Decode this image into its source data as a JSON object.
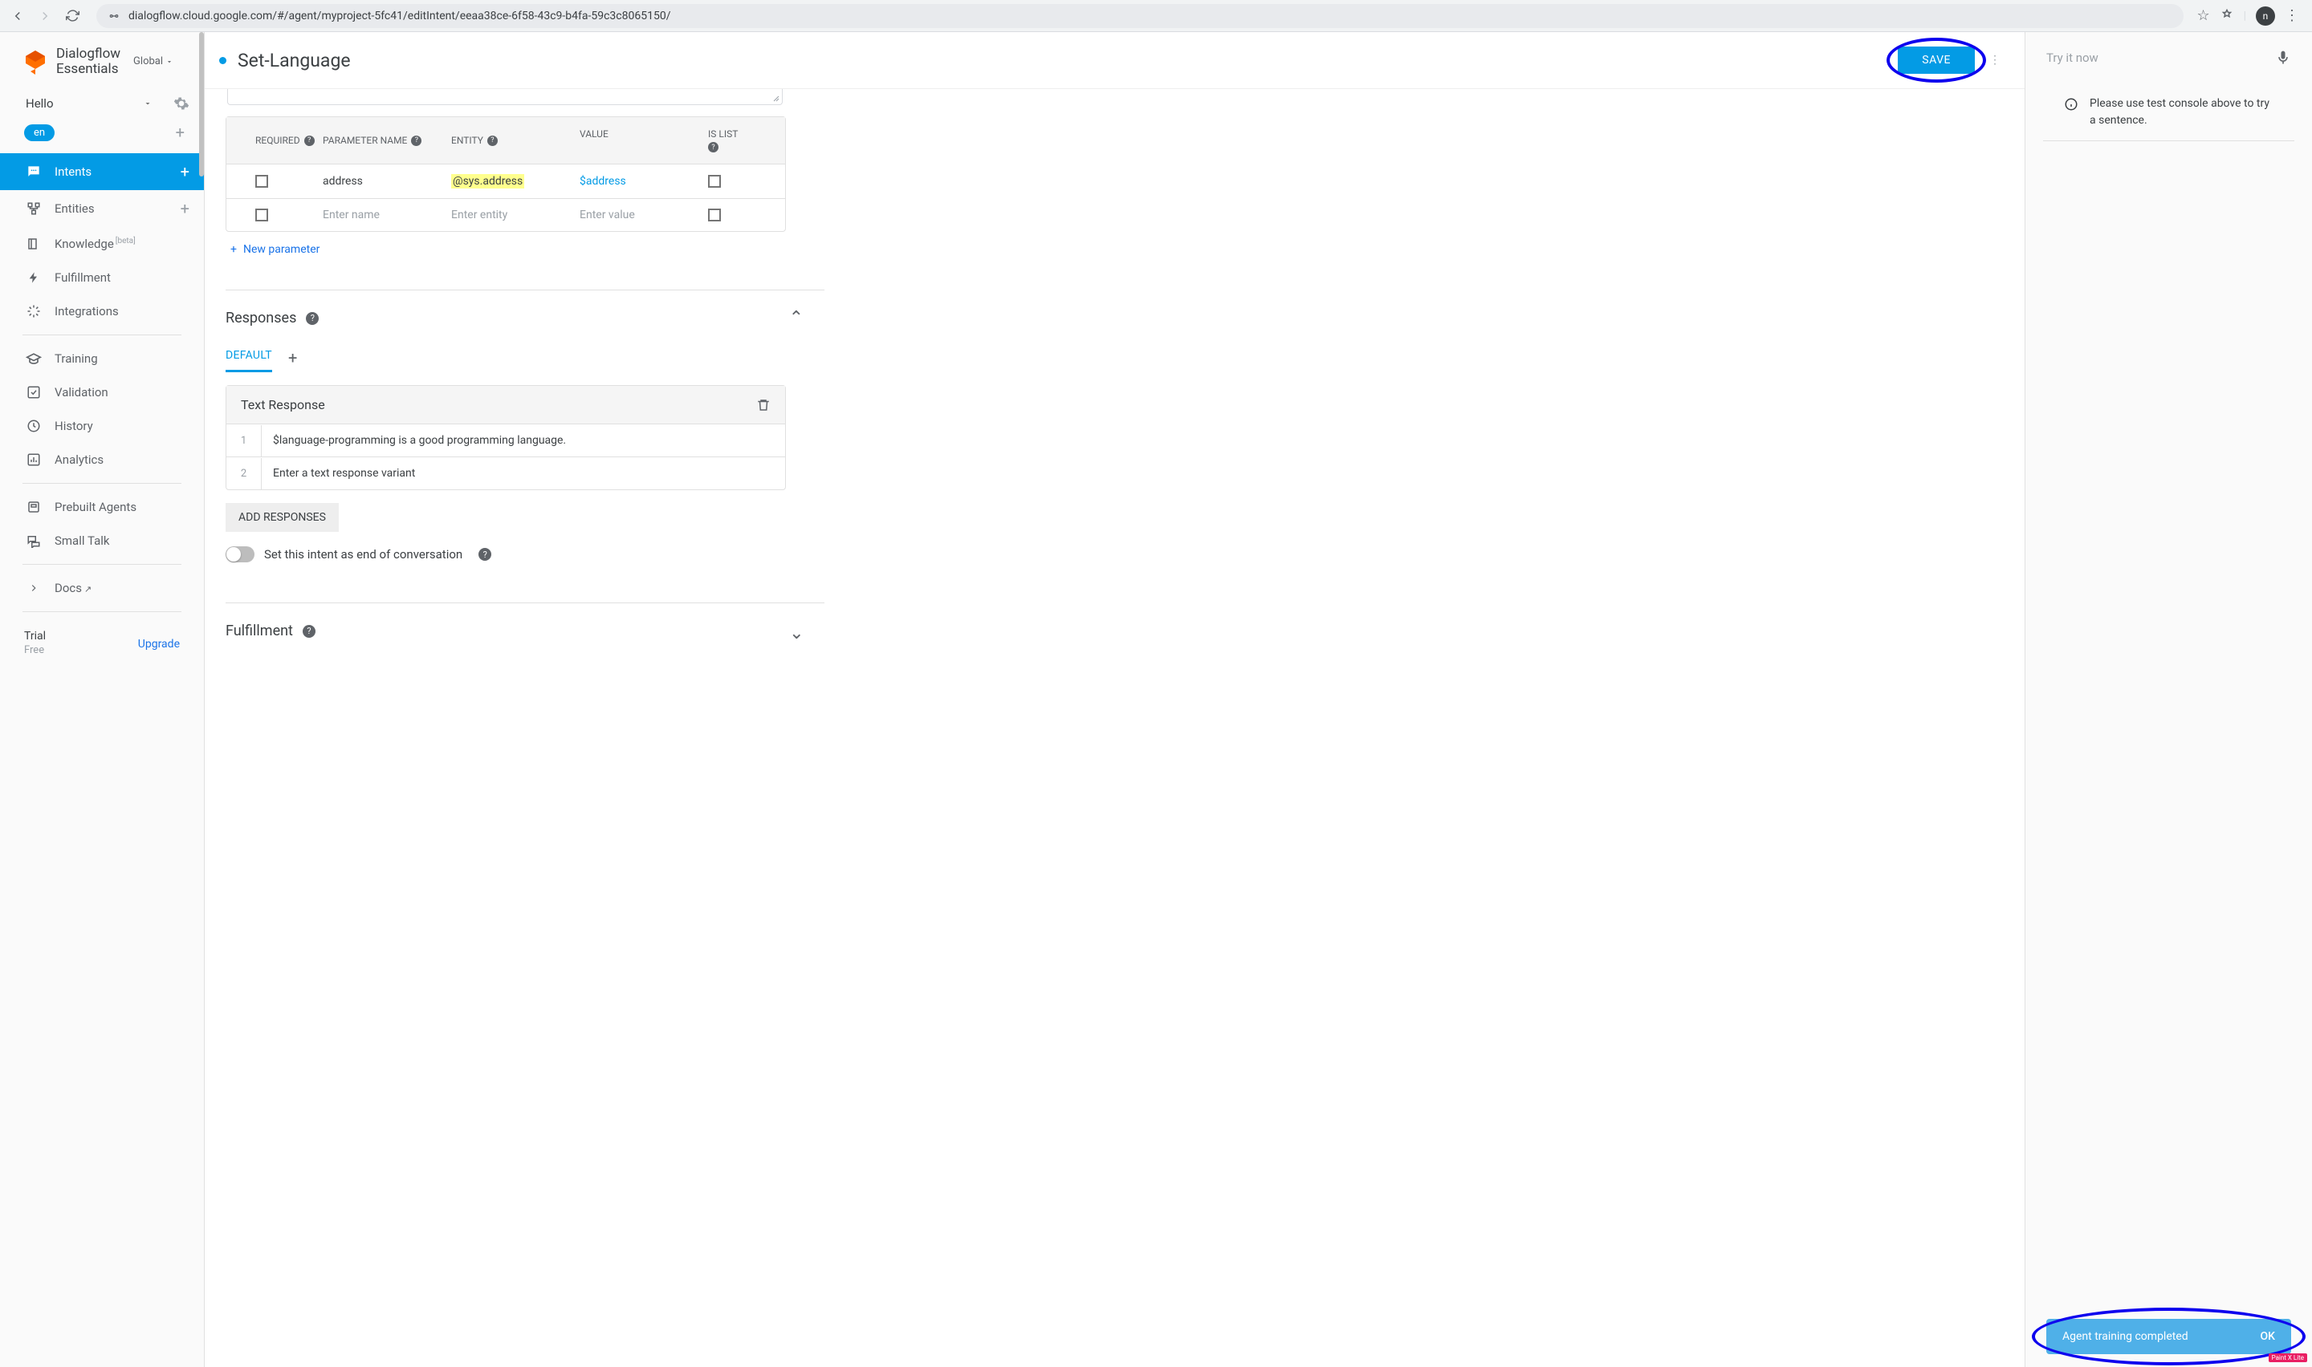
{
  "browser": {
    "url": "dialogflow.cloud.google.com/#/agent/myproject-5fc41/editIntent/eeaa38ce-6f58-43c9-b4fa-59c3c8065150/",
    "avatar": "n"
  },
  "logo": {
    "title": "Dialogflow",
    "subtitle": "Essentials",
    "scope": "Global"
  },
  "agent": {
    "name": "Hello",
    "lang": "en"
  },
  "nav": {
    "intents": "Intents",
    "entities": "Entities",
    "knowledge": "Knowledge",
    "knowledge_badge": "[beta]",
    "fulfillment": "Fulfillment",
    "integrations": "Integrations",
    "training": "Training",
    "validation": "Validation",
    "history": "History",
    "analytics": "Analytics",
    "prebuilt": "Prebuilt Agents",
    "smalltalk": "Small Talk",
    "docs": "Docs"
  },
  "trial": {
    "label": "Trial",
    "sub": "Free",
    "upgrade": "Upgrade"
  },
  "intent": {
    "title": "Set-Language",
    "save": "SAVE"
  },
  "params": {
    "headers": {
      "required": "REQUIRED",
      "name": "PARAMETER NAME",
      "entity": "ENTITY",
      "value": "VALUE",
      "islist": "IS LIST"
    },
    "rows": [
      {
        "name": "address",
        "entity": "@sys.address",
        "value": "$address"
      }
    ],
    "placeholders": {
      "name": "Enter name",
      "entity": "Enter entity",
      "value": "Enter value"
    },
    "new": "New parameter"
  },
  "responses": {
    "title": "Responses",
    "tab": "DEFAULT",
    "card_title": "Text Response",
    "rows": [
      {
        "n": "1",
        "text": "$language-programming is a good programming language."
      },
      {
        "n": "2",
        "text": ""
      }
    ],
    "placeholder": "Enter a text response variant",
    "add_btn": "ADD RESPONSES",
    "end_toggle": "Set this intent as end of conversation"
  },
  "fulfillment_section": {
    "title": "Fulfillment"
  },
  "right": {
    "try": "Try it now",
    "notice": "Please use test console above to try a sentence."
  },
  "toast": {
    "msg": "Agent training completed",
    "ok": "OK"
  },
  "watermark": "Paint X Lite"
}
